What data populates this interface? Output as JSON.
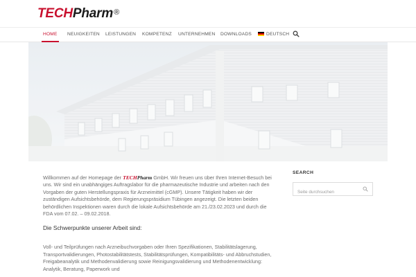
{
  "logo": {
    "tech": "TECH",
    "pharm": "Pharm",
    "reg": "®"
  },
  "nav": {
    "items": [
      "HOME",
      "NEUIGKEITEN",
      "LEISTUNGEN",
      "KOMPETENZ",
      "UNTERNEHMEN",
      "DOWNLOADS"
    ],
    "language": "DEUTSCH",
    "active": "HOME"
  },
  "content": {
    "intro_before": "Willkommen auf der Homepage der ",
    "brand_tech": "TECH",
    "brand_pharm": "Pharm",
    "intro_after": " GmbH. Wir freuen uns über Ihren Internet-Besuch bei uns. Wir sind ein unabhängiges Auftragslabor für die pharmazeutische Industrie und arbeiten nach den Vorgaben der guten Herstellungspraxis für Arzneimittel (cGMP). Unsere Tätigkeit haben wir der zuständigen Aufsichtsbehörde, dem Regierungspräsidium Tübingen angezeigt. Die letzten beiden behördlichen Inspektionen waren durch die lokale Aufsichtsbehörde am 21./23.02.2023 und durch die FDA vom 07.02. – 09.02.2018.",
    "heading": "Die Schwerpunkte unserer Arbeit sind:",
    "focus_text": "Voll- und Teilprüfungen nach Arzneibuchvorgaben oder Ihren Spezifikationen, Stabilitätslagerung, Transportvalidierungen, Photostabilitätstests, Stabilitätsprüfungen, Kompatibilitäts- und Abbruchstudien, Freigabeanalytik und Methodenvalidierung sowie Reinigungsvalidierung und Methodenentwicklung: Analytik, Beratung, Paperwork und"
  },
  "sidebar": {
    "title": "SEARCH",
    "search_placeholder": "Seite durchsuchen"
  },
  "colors": {
    "brand_red": "#c8102e",
    "text_gray": "#6c6c6c"
  },
  "icons": {
    "nav_search": "search-icon",
    "sidebar_search": "search-icon",
    "language_flag": "german-flag-icon"
  }
}
